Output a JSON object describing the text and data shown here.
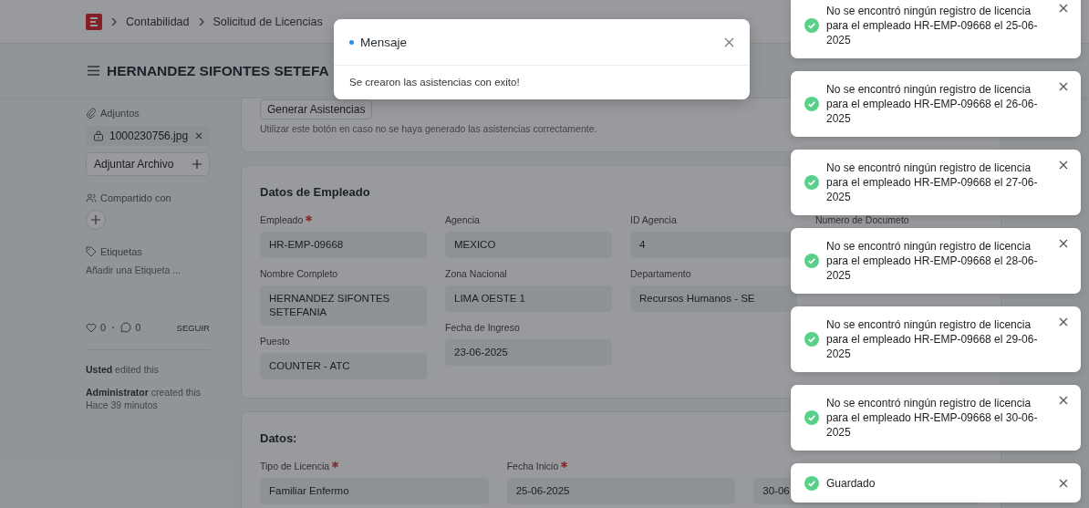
{
  "topbar": {
    "breadcrumbs": [
      "Contabilidad",
      "Solicitud de Licencias"
    ]
  },
  "page": {
    "title": "HERNANDEZ SIFONTES SETEFA"
  },
  "sidebar": {
    "attachments_label": "Adjuntos",
    "attachments": [
      {
        "name": "1000230756.jpg"
      }
    ],
    "attach_button": "Adjuntar Archivo",
    "shared_label": "Compartido con",
    "tags_label": "Etiquetas",
    "add_tag": "Añadir una Etiqueta ...",
    "likes": "0",
    "comments": "0",
    "follow": "SEGUIR",
    "activity": [
      {
        "text": "**Usted** edited this"
      },
      {
        "text": "**Administrator** created this",
        "time": "Hace 39 minutos"
      }
    ]
  },
  "sections": [
    {
      "kind": "actions",
      "button": "Generar Asistencias",
      "help": "Utilizar este botón en caso no se haya generado las asistencias correctamente."
    },
    {
      "kind": "fields",
      "title": "Datos de Empleado",
      "columns": [
        [
          {
            "label": "Empleado",
            "required": true,
            "value": "HR-EMP-09668"
          },
          {
            "label": "Nombre Completo",
            "required": false,
            "value": "HERNANDEZ SIFONTES SETEFANIA"
          },
          {
            "label": "Puesto",
            "required": false,
            "value": "COUNTER - ATC"
          }
        ],
        [
          {
            "label": "Agencia",
            "required": false,
            "value": "MEXICO"
          },
          {
            "label": "Zona Nacional",
            "required": false,
            "value": "LIMA OESTE 1"
          },
          {
            "label": "Fecha de Ingreso",
            "required": false,
            "value": "23-06-2025"
          }
        ],
        [
          {
            "label": "ID Agencia",
            "required": false,
            "value": "4"
          },
          {
            "label": "Departamento",
            "required": false,
            "value": "Recursos Humanos - SE"
          }
        ],
        [
          {
            "label": "Numero de Documeto",
            "required": false
          }
        ]
      ]
    },
    {
      "kind": "fields",
      "title": "Datos:",
      "columns": [
        [
          {
            "label": "Tipo de Licencia",
            "required": true,
            "value": "Familiar Enfermo"
          }
        ],
        [
          {
            "label": "Fecha Inicio",
            "required": true,
            "value": "25-06-2025"
          }
        ],
        [
          {
            "value": "30-06"
          }
        ]
      ]
    }
  ],
  "dialog": {
    "title": "Mensaje",
    "message": "Se crearon las asistencias con exito!"
  },
  "toasts": [
    {
      "kind": "success",
      "message": "No se encontró ningún registro de licencia para el empleado HR-EMP-09668 el 25-06-2025"
    },
    {
      "kind": "success",
      "message": "No se encontró ningún registro de licencia para el empleado HR-EMP-09668 el 26-06-2025"
    },
    {
      "kind": "success",
      "message": "No se encontró ningún registro de licencia para el empleado HR-EMP-09668 el 27-06-2025"
    },
    {
      "kind": "success",
      "message": "No se encontró ningún registro de licencia para el empleado HR-EMP-09668 el 28-06-2025"
    },
    {
      "kind": "success",
      "message": "No se encontró ningún registro de licencia para el empleado HR-EMP-09668 el 29-06-2025"
    },
    {
      "kind": "success",
      "message": "No se encontró ningún registro de licencia para el empleado HR-EMP-09668 el 30-06-2025"
    },
    {
      "kind": "success",
      "message": "Guardado"
    }
  ]
}
